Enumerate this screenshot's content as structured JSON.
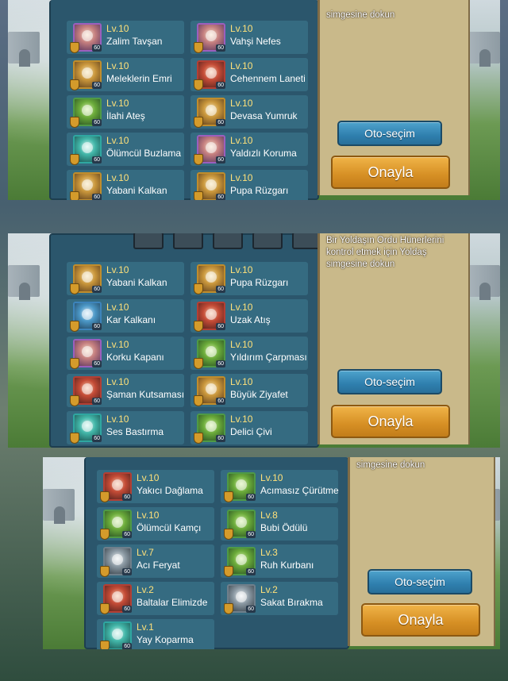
{
  "panels": [
    {
      "instruction": "simgesine dokun",
      "auto_select": "Oto-seçim",
      "confirm": "Onayla",
      "skills": [
        {
          "level": "Lv.10",
          "name": "Zalim Tavşan",
          "color": "purple"
        },
        {
          "level": "Lv.10",
          "name": "Vahşi Nefes",
          "color": "purple"
        },
        {
          "level": "Lv.10",
          "name": "Meleklerin Emri",
          "color": "gold"
        },
        {
          "level": "Lv.10",
          "name": "Cehennem Laneti",
          "color": "red"
        },
        {
          "level": "Lv.10",
          "name": "İlahi Ateş",
          "color": "green"
        },
        {
          "level": "Lv.10",
          "name": "Devasa Yumruk",
          "color": "gold"
        },
        {
          "level": "Lv.10",
          "name": "Ölümcül Buzlama",
          "color": "cyan"
        },
        {
          "level": "Lv.10",
          "name": "Yaldızlı Koruma",
          "color": "purple"
        },
        {
          "level": "Lv.10",
          "name": "Yabani Kalkan",
          "color": "gold"
        },
        {
          "level": "Lv.10",
          "name": "Pupa Rüzgarı",
          "color": "gold"
        }
      ]
    },
    {
      "instruction": "Bir Yoldaşın Ordu Hünerlerini kontrol etmek için Yoldaş simgesine dokun",
      "auto_select": "Oto-seçim",
      "confirm": "Onayla",
      "skills": [
        {
          "level": "Lv.10",
          "name": "Yabani Kalkan",
          "color": "gold"
        },
        {
          "level": "Lv.10",
          "name": "Pupa Rüzgarı",
          "color": "gold"
        },
        {
          "level": "Lv.10",
          "name": "Kar Kalkanı",
          "color": "blue"
        },
        {
          "level": "Lv.10",
          "name": "Uzak Atış",
          "color": "red"
        },
        {
          "level": "Lv.10",
          "name": "Korku Kapanı",
          "color": "purple"
        },
        {
          "level": "Lv.10",
          "name": "Yıldırım Çarpması",
          "color": "green"
        },
        {
          "level": "Lv.10",
          "name": "Şaman Kutsaması",
          "color": "red"
        },
        {
          "level": "Lv.10",
          "name": "Büyük Ziyafet",
          "color": "gold"
        },
        {
          "level": "Lv.10",
          "name": "Ses Bastırma",
          "color": "cyan"
        },
        {
          "level": "Lv.10",
          "name": "Delici Çivi",
          "color": "green"
        }
      ]
    },
    {
      "instruction": "simgesine dokun",
      "auto_select": "Oto-seçim",
      "confirm": "Onayla",
      "skills": [
        {
          "level": "Lv.10",
          "name": "Yakıcı Dağlama",
          "color": "red"
        },
        {
          "level": "Lv.10",
          "name": "Acımasız Çürütme",
          "color": "green"
        },
        {
          "level": "Lv.10",
          "name": "Ölümcül Kamçı",
          "color": "green"
        },
        {
          "level": "Lv.8",
          "name": "Bubi Ödülü",
          "color": "green"
        },
        {
          "level": "Lv.7",
          "name": "Acı Feryat",
          "color": "grey"
        },
        {
          "level": "Lv.3",
          "name": "Ruh Kurbanı",
          "color": "green"
        },
        {
          "level": "Lv.2",
          "name": "Baltalar Elimizde",
          "color": "red"
        },
        {
          "level": "Lv.2",
          "name": "Sakat Bırakma",
          "color": "grey"
        },
        {
          "level": "Lv.1",
          "name": "Yay Koparma",
          "color": "cyan"
        }
      ]
    }
  ],
  "badge_level": "60"
}
